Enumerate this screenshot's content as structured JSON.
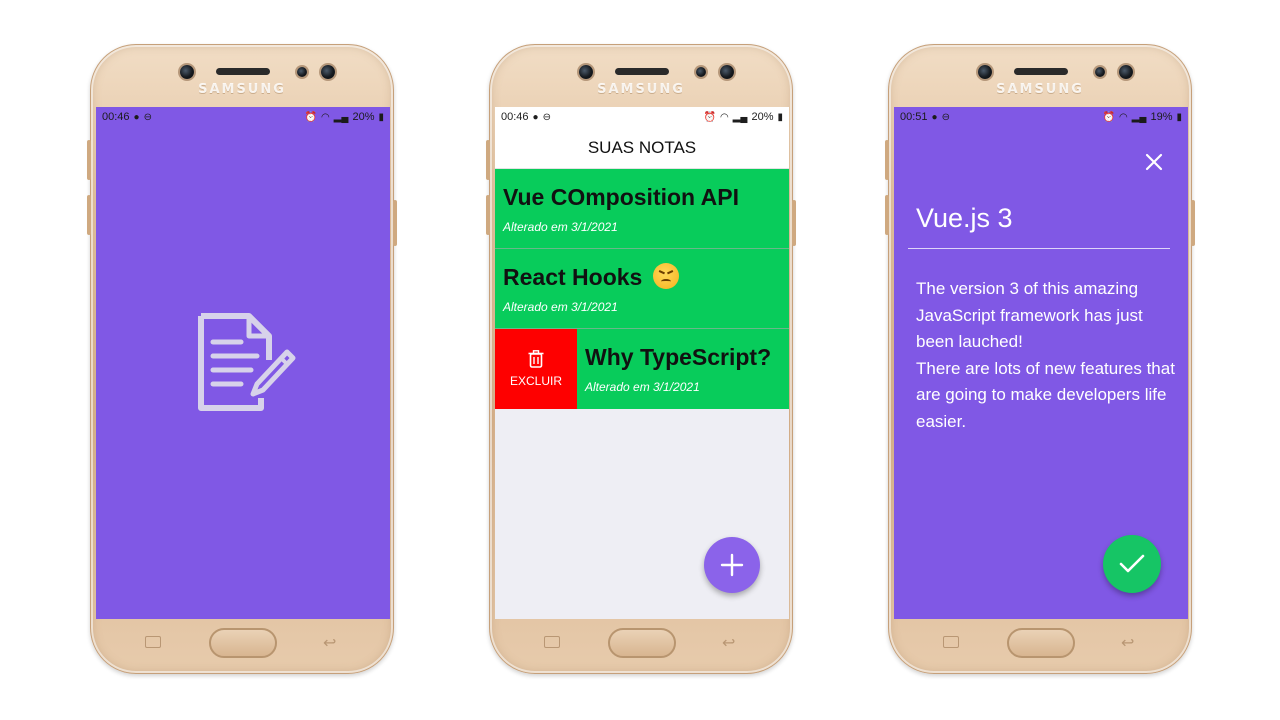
{
  "device": {
    "brand": "SAMSUNG"
  },
  "colors": {
    "primary": "#8058e5",
    "note_green": "#08cc5b",
    "delete_red": "#fe0000",
    "fab_green": "#16c565"
  },
  "phones": [
    {
      "status": {
        "time": "00:46",
        "battery": "20%"
      },
      "screen": "splash",
      "logo_icon": "note-edit-icon"
    },
    {
      "status": {
        "time": "00:46",
        "battery": "20%"
      },
      "screen": "notes-list",
      "header_title": "SUAS NOTAS",
      "notes": [
        {
          "title": "Vue COmposition API",
          "date": "Alterado em 3/1/2021"
        },
        {
          "title": "React Hooks",
          "date": "Alterado em 3/1/2021",
          "emoji": "confounded-face"
        },
        {
          "title": "Why TypeScript?",
          "date": "Alterado em 3/1/2021",
          "swiped": true
        }
      ],
      "delete_label": "EXCLUIR",
      "fab_icon": "plus-icon"
    },
    {
      "status": {
        "time": "00:51",
        "battery": "19%"
      },
      "screen": "note-editor",
      "close_icon": "close-icon",
      "note_title": "Vue.js 3",
      "note_body_lines": [
        "The version 3 of this amazing JavaScript framework has just been lauched!",
        "There are lots of new features that are going to make developers life easier."
      ],
      "fab_icon": "check-icon"
    }
  ]
}
